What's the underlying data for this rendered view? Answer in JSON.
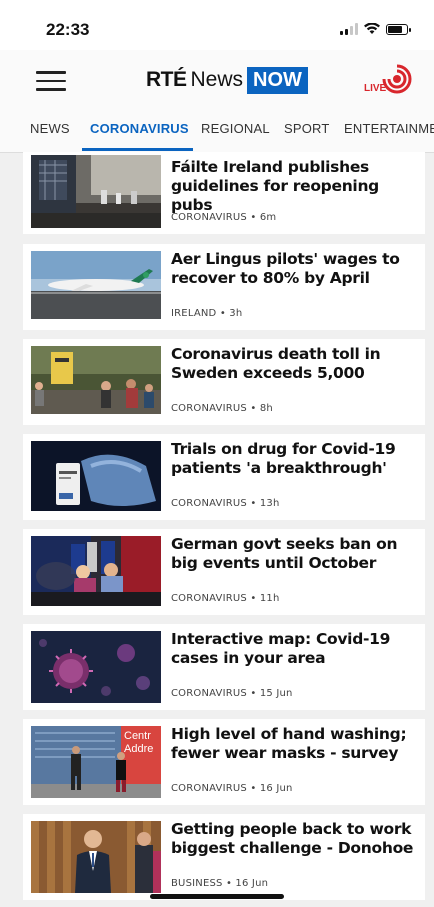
{
  "status": {
    "time": "22:33"
  },
  "header": {
    "brand_rte": "RTÉ",
    "brand_news": "News",
    "brand_now": "NOW",
    "live_label": "LIVE"
  },
  "tabs": [
    {
      "label": "NEWS",
      "active": false
    },
    {
      "label": "CORONAVIRUS",
      "active": true
    },
    {
      "label": "REGIONAL",
      "active": false
    },
    {
      "label": "SPORT",
      "active": false
    },
    {
      "label": "ENTERTAINMENT",
      "active": false
    }
  ],
  "articles": [
    {
      "title": "Fáilte Ireland publishes guidelines for reopening pubs",
      "meta": "CORONAVIRUS • 6m"
    },
    {
      "title": "Aer Lingus pilots' wages to recover to 80% by April",
      "meta": "IRELAND • 3h"
    },
    {
      "title": "Coronavirus death toll in Sweden exceeds 5,000",
      "meta": "CORONAVIRUS • 8h"
    },
    {
      "title": "Trials on drug for Covid-19 patients 'a breakthrough'",
      "meta": "CORONAVIRUS • 13h"
    },
    {
      "title": "German govt seeks ban on big events until October",
      "meta": "CORONAVIRUS • 11h"
    },
    {
      "title": "Interactive map: Covid-19 cases in your area",
      "meta": "CORONAVIRUS • 15 Jun"
    },
    {
      "title": "High level of hand washing; fewer wear masks - survey",
      "meta": "CORONAVIRUS • 16 Jun"
    },
    {
      "title": "Getting people back to work biggest challenge - Donohoe",
      "meta": "BUSINESS • 16 Jun"
    }
  ],
  "thumb_signs": {
    "a7_line1": "Centr",
    "a7_line2": "Addre"
  },
  "colors": {
    "accent": "#0b64c0",
    "live": "#d8262c"
  }
}
